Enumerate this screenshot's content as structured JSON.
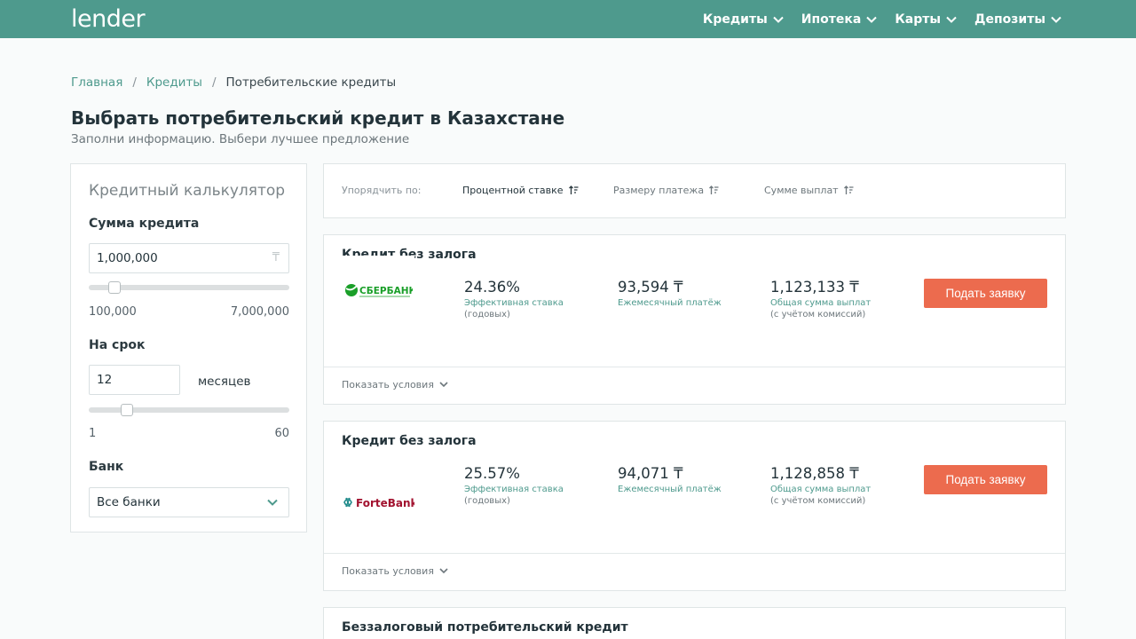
{
  "header": {
    "logo": "lender",
    "nav": [
      {
        "label": "Кредиты"
      },
      {
        "label": "Ипотека"
      },
      {
        "label": "Карты"
      },
      {
        "label": "Депозиты"
      }
    ]
  },
  "breadcrumb": {
    "home": "Главная",
    "credits": "Кредиты",
    "current": "Потребительские кредиты",
    "separator": "/"
  },
  "page": {
    "title": "Выбрать потребительский кредит в Казахстане",
    "subtitle": "Заполни информацию. Выбери лучшее предложение"
  },
  "calculator": {
    "title": "Кредитный калькулятор",
    "amount_label": "Сумма кредита",
    "amount_value": "1,000,000",
    "currency_symbol": "₸",
    "amount_min": "100,000",
    "amount_max": "7,000,000",
    "amount_slider_fraction": 0.13,
    "term_label": "На срок",
    "term_value": "12",
    "term_unit": "месяцев",
    "term_min": "1",
    "term_max": "60",
    "term_slider_fraction": 0.19,
    "bank_label": "Банк",
    "bank_value": "Все банки"
  },
  "sort": {
    "label": "Упорядчить по:",
    "options": [
      {
        "label": "Процентной ставке",
        "active": true
      },
      {
        "label": "Размеру платежа",
        "active": false
      },
      {
        "label": "Сумме выплат",
        "active": false
      }
    ]
  },
  "offers": [
    {
      "title": "Кредит без залога",
      "bank": "СБЕРБАНК",
      "rate": "24.36%",
      "rate_caption": "Эффективная ставка",
      "rate_sub": "(годовых)",
      "payment": "93,594 ₸",
      "payment_caption": "Ежемесячный платёж",
      "total": "1,123,133 ₸",
      "total_caption": "Общая сумма выплат",
      "total_sub": "(с учётом комиссий)",
      "apply_label": "Подать заявку",
      "show_terms": "Показать условия"
    },
    {
      "title": "Кредит без залога",
      "bank": "ForteBank",
      "rate": "25.57%",
      "rate_caption": "Эффективная ставка",
      "rate_sub": "(годовых)",
      "payment": "94,071 ₸",
      "payment_caption": "Ежемесячный платёж",
      "total": "1,128,858 ₸",
      "total_caption": "Общая сумма выплат",
      "total_sub": "(с учётом комиссий)",
      "apply_label": "Подать заявку",
      "show_terms": "Показать условия"
    },
    {
      "title": "Беззалоговый потребительский кредит"
    }
  ],
  "colors": {
    "brand": "#4e9a8d",
    "accent_button": "#ec6b4e",
    "sber_green": "#1a9f29",
    "forte_red": "#a2122f"
  }
}
